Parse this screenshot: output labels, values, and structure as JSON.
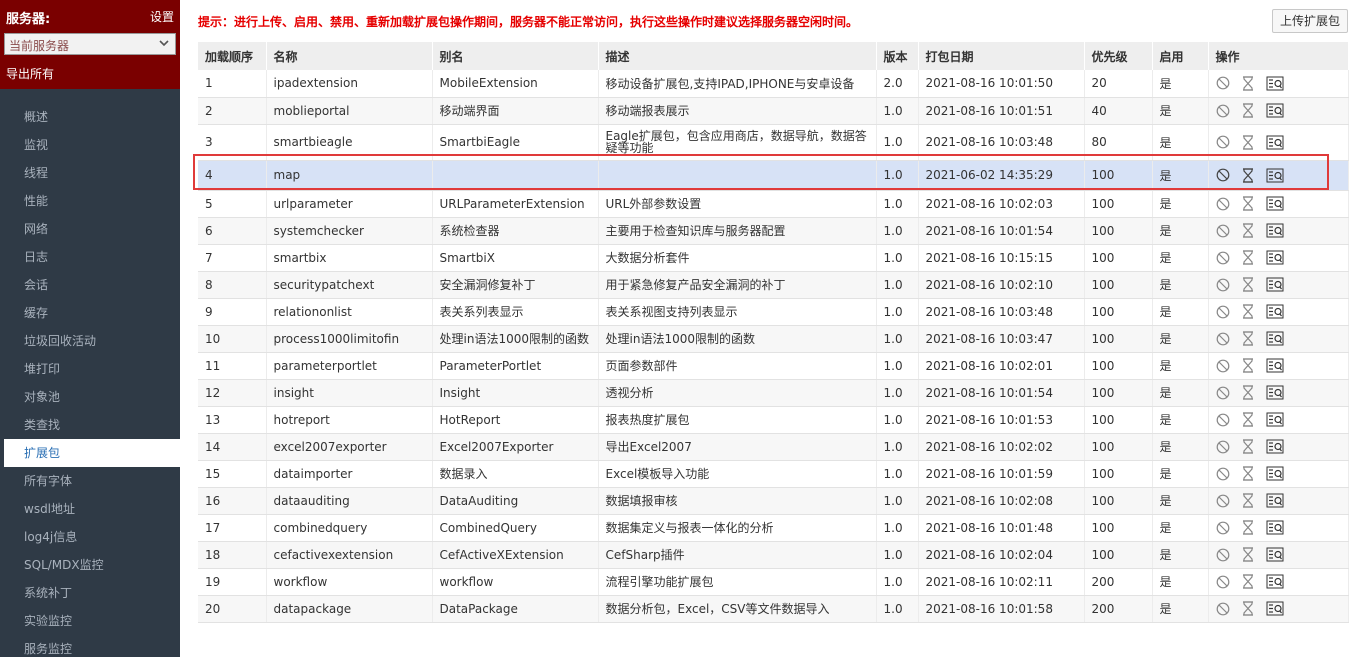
{
  "sidebar": {
    "server_label": "服务器:",
    "settings": "设置",
    "server_select": "当前服务器",
    "export_all": "导出所有",
    "items": [
      {
        "label": "概述"
      },
      {
        "label": "监视"
      },
      {
        "label": "线程"
      },
      {
        "label": "性能"
      },
      {
        "label": "网络"
      },
      {
        "label": "日志"
      },
      {
        "label": "会话"
      },
      {
        "label": "缓存"
      },
      {
        "label": "垃圾回收活动"
      },
      {
        "label": "堆打印"
      },
      {
        "label": "对象池"
      },
      {
        "label": "类查找"
      },
      {
        "label": "扩展包"
      },
      {
        "label": "所有字体"
      },
      {
        "label": "wsdl地址"
      },
      {
        "label": "log4j信息"
      },
      {
        "label": "SQL/MDX监控"
      },
      {
        "label": "系统补丁"
      },
      {
        "label": "实验监控"
      },
      {
        "label": "服务监控"
      }
    ],
    "active_index": 12
  },
  "main": {
    "notice": "提示：进行上传、启用、禁用、重新加载扩展包操作期间，服务器不能正常访问，执行这些操作时建议选择服务器空闲时间。",
    "upload_label": "上传扩展包"
  },
  "table": {
    "headers": [
      "加载顺序",
      "名称",
      "别名",
      "描述",
      "版本",
      "打包日期",
      "优先级",
      "启用",
      "操作"
    ],
    "rows": [
      [
        "1",
        "ipadextension",
        "MobileExtension",
        "移动设备扩展包,支持IPAD,IPHONE与安卓设备",
        "2.0",
        "2021-08-16 10:01:50",
        "20",
        "是"
      ],
      [
        "2",
        "moblieportal",
        "移动端界面",
        "移动端报表展示",
        "1.0",
        "2021-08-16 10:01:51",
        "40",
        "是"
      ],
      [
        "3",
        "smartbieagle",
        "SmartbiEagle",
        "Eagle扩展包，包含应用商店，数据导航，数据答疑等功能",
        "1.0",
        "2021-08-16 10:03:48",
        "80",
        "是"
      ],
      [
        "4",
        "map",
        "",
        "",
        "1.0",
        "2021-06-02 14:35:29",
        "100",
        "是"
      ],
      [
        "5",
        "urlparameter",
        "URLParameterExtension",
        "URL外部参数设置",
        "1.0",
        "2021-08-16 10:02:03",
        "100",
        "是"
      ],
      [
        "6",
        "systemchecker",
        "系统检查器",
        "主要用于检查知识库与服务器配置",
        "1.0",
        "2021-08-16 10:01:54",
        "100",
        "是"
      ],
      [
        "7",
        "smartbix",
        "SmartbiX",
        "大数据分析套件",
        "1.0",
        "2021-08-16 10:15:15",
        "100",
        "是"
      ],
      [
        "8",
        "securitypatchext",
        "安全漏洞修复补丁",
        "用于紧急修复产品安全漏洞的补丁",
        "1.0",
        "2021-08-16 10:02:10",
        "100",
        "是"
      ],
      [
        "9",
        "relationonlist",
        "表关系列表显示",
        "表关系视图支持列表显示",
        "1.0",
        "2021-08-16 10:03:48",
        "100",
        "是"
      ],
      [
        "10",
        "process1000limitofin",
        "处理in语法1000限制的函数",
        "处理in语法1000限制的函数",
        "1.0",
        "2021-08-16 10:03:47",
        "100",
        "是"
      ],
      [
        "11",
        "parameterportlet",
        "ParameterPortlet",
        "页面参数部件",
        "1.0",
        "2021-08-16 10:02:01",
        "100",
        "是"
      ],
      [
        "12",
        "insight",
        "Insight",
        "透视分析",
        "1.0",
        "2021-08-16 10:01:54",
        "100",
        "是"
      ],
      [
        "13",
        "hotreport",
        "HotReport",
        "报表热度扩展包",
        "1.0",
        "2021-08-16 10:01:53",
        "100",
        "是"
      ],
      [
        "14",
        "excel2007exporter",
        "Excel2007Exporter",
        "导出Excel2007",
        "1.0",
        "2021-08-16 10:02:02",
        "100",
        "是"
      ],
      [
        "15",
        "dataimporter",
        "数据录入",
        "Excel模板导入功能",
        "1.0",
        "2021-08-16 10:01:59",
        "100",
        "是"
      ],
      [
        "16",
        "dataauditing",
        "DataAuditing",
        "数据填报审核",
        "1.0",
        "2021-08-16 10:02:08",
        "100",
        "是"
      ],
      [
        "17",
        "combinedquery",
        "CombinedQuery",
        "数据集定义与报表一体化的分析",
        "1.0",
        "2021-08-16 10:01:48",
        "100",
        "是"
      ],
      [
        "18",
        "cefactivexextension",
        "CefActiveXExtension",
        "CefSharp插件",
        "1.0",
        "2021-08-16 10:02:04",
        "100",
        "是"
      ],
      [
        "19",
        "workflow",
        "workflow",
        "流程引擎功能扩展包",
        "1.0",
        "2021-08-16 10:02:11",
        "200",
        "是"
      ],
      [
        "20",
        "datapackage",
        "DataPackage",
        "数据分析包，Excel，CSV等文件数据导入",
        "1.0",
        "2021-08-16 10:01:58",
        "200",
        "是"
      ]
    ],
    "selected_index": 3,
    "op_icons": [
      "disable-icon",
      "hourglass-icon",
      "eq-icon"
    ]
  },
  "colors": {
    "sidebar_bg": "#2f3a46",
    "sidebar_top_bg": "#7a0000",
    "notice_red": "#e60000",
    "selected_row": "#d7e2f6",
    "highlight_border": "#e03a3a"
  }
}
